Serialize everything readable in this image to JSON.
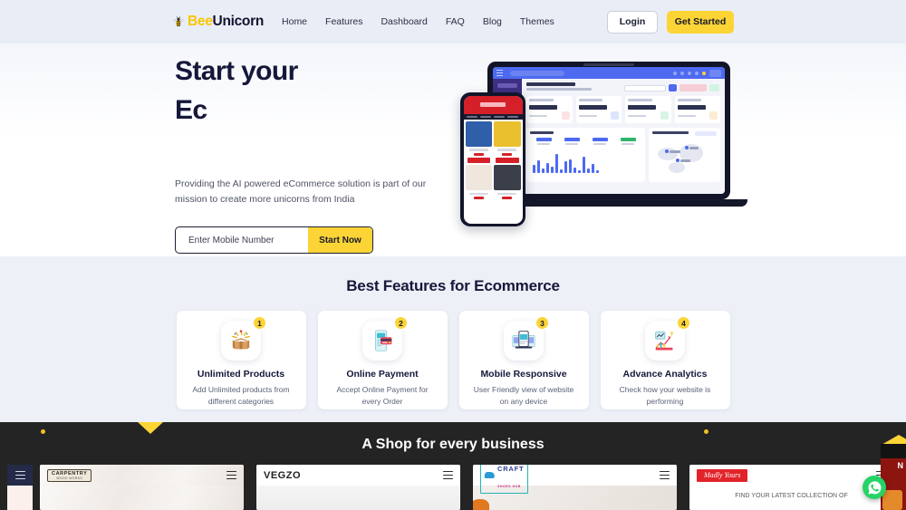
{
  "header": {
    "logo": {
      "icon": "bee-icon",
      "part1": "Bee",
      "part2": "Unicorn"
    },
    "nav": [
      {
        "label": "Home"
      },
      {
        "label": "Features"
      },
      {
        "label": "Dashboard"
      },
      {
        "label": "FAQ"
      },
      {
        "label": "Blog"
      },
      {
        "label": "Themes"
      }
    ],
    "login_label": "Login",
    "get_started_label": "Get Started",
    "background": "#e9edf6",
    "accent": "#fcd436"
  },
  "hero": {
    "title_line1": "Start your",
    "title_line2": "Ec",
    "subtitle": "Providing the AI powered eCommerce solution is part of our mission to create more unicorns from India",
    "input_placeholder": "Enter Mobile Number",
    "input_value": "",
    "cta_label": "Start Now",
    "illustration": "laptop-and-phone-dashboard-mockup"
  },
  "features": {
    "title": "Best Features for Ecommerce",
    "background": "#edf0f7",
    "cards": [
      {
        "badge": "1",
        "icon": "open-box-icon",
        "title": "Unlimited Products",
        "desc": "Add Unlimited products from different categories"
      },
      {
        "badge": "2",
        "icon": "mobile-payment-icon",
        "title": "Online Payment",
        "desc": "Accept Online Payment for every Order"
      },
      {
        "badge": "3",
        "icon": "responsive-devices-icon",
        "title": "Mobile Responsive",
        "desc": "User Friendly view of website on any device"
      },
      {
        "badge": "4",
        "icon": "analytics-chart-icon",
        "title": "Advance Analytics",
        "desc": "Check how your website is performing"
      }
    ]
  },
  "shops": {
    "title": "A Shop for every business",
    "background": "#242424",
    "accent": "#fcd436",
    "items": [
      {
        "name": "CARPENTRY",
        "tagline": "WOOD WORKS",
        "theme": "marble"
      },
      {
        "name": "VEGZO",
        "tagline": "",
        "theme": "lightgrey"
      },
      {
        "name": "CRAFT",
        "tagline": "SHOES HUB",
        "theme": "bodybeige"
      },
      {
        "name": "Madly Yours",
        "tagline": "FIND YOUR LATEST COLLECTION OF",
        "theme": "white"
      }
    ]
  },
  "floating": {
    "whatsapp_label": "whatsapp-icon"
  }
}
